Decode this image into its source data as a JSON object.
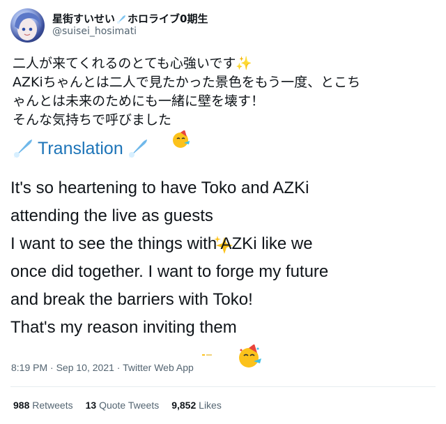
{
  "author": {
    "display_name": "星街すいせい",
    "display_name_suffix": "ホロライブ0期生",
    "handle": "@suisei_hosimati"
  },
  "tweet": {
    "jp_text": "二人が来てくれるのとても心強いです✨\nAZKiちゃんとは二人で見たかった景色をもう一度、とこち\nゃんとは未来のためにも一緒に壁を壊す！\nそんな気持ちで呼びました",
    "translation_label": "Translation",
    "en_line1": "It's so heartening to have Toko and AZKi",
    "en_line2": "attending the live as guests",
    "en_line3": "I want to see the things with AZKi like we",
    "en_line4": "once did together. I want to forge my future",
    "en_line5": "and break the barriers with Toko!",
    "en_line6": "That's my reason inviting them"
  },
  "meta": {
    "time": "8:19 PM",
    "date": "Sep 10, 2021",
    "source": "Twitter Web App",
    "separator": "·"
  },
  "stats": {
    "retweets_count": "988",
    "retweets_label": "Retweets",
    "quotes_count": "13",
    "quotes_label": "Quote Tweets",
    "likes_count": "9,852",
    "likes_label": "Likes"
  },
  "icons": {
    "comet": "comet-icon",
    "sparkles": "sparkles-icon",
    "partying_face": "partying-face-icon"
  },
  "colors": {
    "translation_blue": "#1d74b8",
    "secondary_text": "#536471",
    "primary_text": "#0f1419"
  }
}
